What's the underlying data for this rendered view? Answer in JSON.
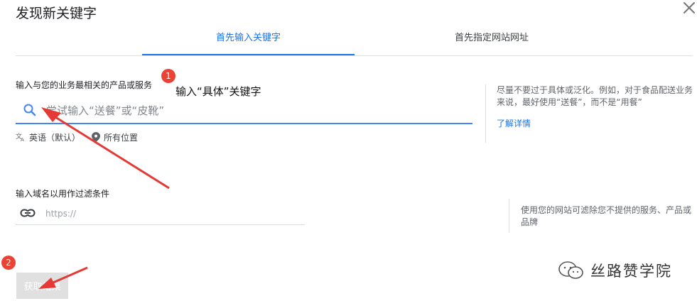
{
  "dialog": {
    "title": "发现新关键字"
  },
  "tabs": [
    {
      "label": "首先输入关键字",
      "active": true
    },
    {
      "label": "首先指定网站网址",
      "active": false
    }
  ],
  "keyword_section": {
    "label": "输入与您的业务最相关的产品或服务",
    "placeholder": "尝试输入“送餐”或“皮靴”",
    "language": "英语（默认）",
    "location": "所有位置",
    "language_icon": "translate-icon",
    "location_icon": "location-pin-icon",
    "search_icon": "search-icon"
  },
  "keyword_tip": {
    "text": "尽量不要过于具体或泛化。例如，对于食品配送业务来说，最好使用“送餐”，而不是“用餐”",
    "learn_more": "了解详情"
  },
  "domain_section": {
    "label": "输入域名以用作过滤条件",
    "placeholder": "https://",
    "link_icon": "link-icon"
  },
  "domain_tip": {
    "text": "使用您的网站可滤除您不提供的服务、产品或品牌"
  },
  "submit": {
    "label": "获取结果"
  },
  "annotations": {
    "badge_1": "1",
    "badge_2": "2",
    "note_1": "输入“具体”关键字",
    "arrow_color": "#e53935"
  },
  "watermark": {
    "text": "丝路赞学院",
    "icon": "wechat-icon"
  },
  "colors": {
    "accent": "#1a73e8",
    "badge": "#ea4335",
    "disabled_button": "#e0e0e0"
  }
}
